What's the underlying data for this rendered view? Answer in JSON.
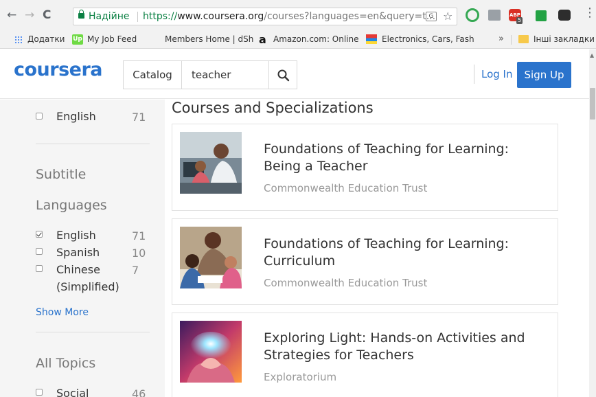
{
  "browser": {
    "nav": {
      "back": "←",
      "forward": "→",
      "reload": "C"
    },
    "security_label": "Надійне",
    "url_scheme": "https://",
    "url_host": "www.coursera.org",
    "url_path": "/courses?languages=en&query=t...",
    "translate_icon_text": "G",
    "star": "☆",
    "abp_text": "ABP",
    "abp_badge": "5",
    "menu": "⋮"
  },
  "bookmarks": {
    "items": [
      {
        "label": "Додатки"
      },
      {
        "label": "My Job Feed",
        "icon_text": "Up"
      },
      {
        "label": "Members Home | dSh"
      },
      {
        "label": "Amazon.com: Online",
        "icon_text": "a"
      },
      {
        "label": "Electronics, Cars, Fash"
      }
    ],
    "more": "»",
    "other": "Інші закладки"
  },
  "header": {
    "logo": "coursera",
    "catalog": "Catalog",
    "search_value": "teacher",
    "login": "Log In",
    "signup": "Sign Up"
  },
  "sidebar": {
    "top_item": {
      "label": "English",
      "count": "71"
    },
    "subtitle_heading_1": "Subtitle",
    "subtitle_heading_2": "Languages",
    "subtitle_items": [
      {
        "label": "English",
        "count": "71",
        "checked": true
      },
      {
        "label": "Spanish",
        "count": "10",
        "checked": false
      },
      {
        "label": "Chinese",
        "label2": "(Simplified)",
        "count": "7",
        "checked": false
      }
    ],
    "show_more": "Show More",
    "topics_heading": "All Topics",
    "topic_items": [
      {
        "label": "Social",
        "count": "46"
      }
    ]
  },
  "main": {
    "section_title": "Courses and Specializations",
    "courses": [
      {
        "title": "Foundations of Teaching for Learning: Being a Teacher",
        "partner": "Commonwealth Education Trust"
      },
      {
        "title": "Foundations of Teaching for Learning: Curriculum",
        "partner": "Commonwealth Education Trust"
      },
      {
        "title": "Exploring Light: Hands-on Activities and Strategies for Teachers",
        "partner": "Exploratorium"
      }
    ]
  },
  "colors": {
    "brand_blue": "#2a73cc",
    "secure_green": "#0b8043",
    "sidebar_bg": "#f5f5f5"
  }
}
